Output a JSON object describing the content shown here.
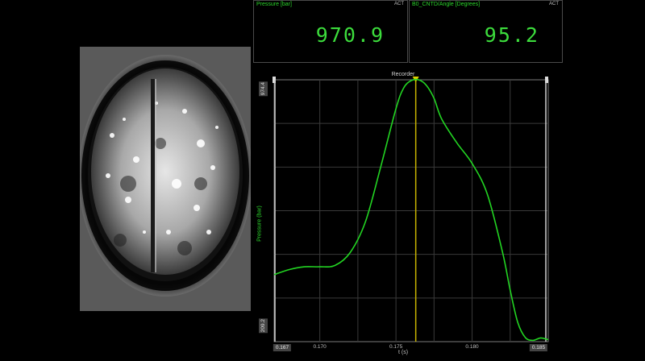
{
  "panels": {
    "pressure": {
      "title": "Pressure [bar]",
      "tag": "ACT",
      "value": "970.9"
    },
    "angle": {
      "title": "B0_CNTD/Angle [Degrees]",
      "tag": "ACT",
      "value": "95.2"
    }
  },
  "recorder": {
    "title": "Recorder",
    "y_axis_label": "Pressure (bar)",
    "x_axis_label": "t (s)",
    "y_max_label": "974.4",
    "y_min_label": "209.2",
    "x_ticks": [
      "0.167",
      "0.170",
      "0.175",
      "0.180",
      "0.185"
    ]
  },
  "colors": {
    "trace": "#22d422",
    "cursor": "#c8b400",
    "value_text": "#3cdc3c"
  },
  "chart_data": {
    "type": "line",
    "title": "Recorder",
    "xlabel": "t (s)",
    "ylabel": "Pressure (bar)",
    "xlim": [
      0.167,
      0.185
    ],
    "ylim": [
      209.2,
      974.4
    ],
    "grid": true,
    "cursor_x": 0.1763,
    "series": [
      {
        "x": [
          0.167,
          0.168,
          0.169,
          0.17,
          0.171,
          0.172,
          0.173,
          0.174,
          0.175,
          0.1755,
          0.176,
          0.1765,
          0.177,
          0.1775,
          0.178,
          0.179,
          0.18,
          0.181,
          0.182,
          0.1825,
          0.183,
          0.1835,
          0.184,
          0.1845,
          0.185
        ],
        "values": [
          405,
          420,
          428,
          428,
          432,
          470,
          560,
          720,
          890,
          950,
          972,
          974,
          958,
          920,
          860,
          790,
          730,
          640,
          470,
          360,
          265,
          221,
          213,
          220,
          215
        ]
      }
    ]
  }
}
